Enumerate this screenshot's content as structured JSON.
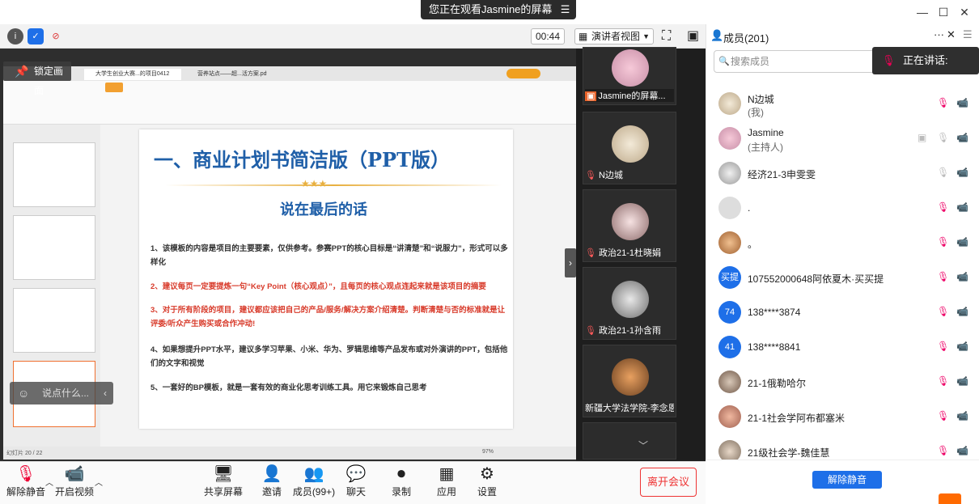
{
  "banner": {
    "viewing": "您正在观看Jasmine的屏幕"
  },
  "toolbar": {
    "timer": "00:44",
    "view_mode": "演讲者视图"
  },
  "share": {
    "lock_label": "锁定画面",
    "wps_tab1": "大学生创业大赛...的项目0412",
    "wps_tab2": "营养站点——超...活方案.pdf",
    "slide_title": "一、商业计划书简洁版（PPT版）",
    "slide_subtitle": "说在最后的话",
    "lines": [
      "1、该模板的内容是项目的主要要素，仅供参考。参赛PPT的核心目标是“讲清楚”和“说服力”，形式可以多样化",
      "2、建议每页一定要提炼一句“Key Point（核心观点）”，且每页的核心观点连起来就是该项目的摘要",
      "3、对于所有阶段的项目，建议都应该把自己的产品/服务/解决方案介绍清楚。判断清楚与否的标准就是让评委/听众产生购买或合作冲动!",
      "4、如果想提升PPT水平，建议多学习苹果、小米、华为、罗辑思维等产品发布或对外演讲的PPT，包括他们的文字和视觉",
      "5、一套好的BP模板，就是一套有效的商业化思考训练工具。用它来锻炼自己思考"
    ],
    "say_placeholder": "说点什么...",
    "status_left": "幻灯片 20 / 22",
    "zoom": "97%"
  },
  "video_tiles": [
    {
      "name": "Jasmine的屏幕..."
    },
    {
      "name": "N边城"
    },
    {
      "name": "政治21-1杜晓娟"
    },
    {
      "name": "政治21-1孙含雨"
    },
    {
      "name": "新疆大学法学院-李念恩"
    }
  ],
  "members": {
    "title": "成员(201)",
    "search_placeholder": "搜索成员",
    "speaking": "正在讲话:",
    "unmute_all": "解除静音",
    "list": [
      {
        "name": "N边城",
        "role": "(我)",
        "avatar": ""
      },
      {
        "name": "Jasmine",
        "role": "(主持人)",
        "avatar": ""
      },
      {
        "name": "经济21-3申雯雯",
        "role": "",
        "avatar": ""
      },
      {
        "name": ".",
        "role": "",
        "avatar": ""
      },
      {
        "name": "。",
        "role": "",
        "avatar": ""
      },
      {
        "name": "107552000648阿依夏木·买买提",
        "role": "",
        "avatar": "买提"
      },
      {
        "name": "138****3874",
        "role": "",
        "avatar": "74"
      },
      {
        "name": "138****8841",
        "role": "",
        "avatar": "41"
      },
      {
        "name": "21-1俄勒哈尔",
        "role": "",
        "avatar": ""
      },
      {
        "name": "21-1社会学阿布都塞米",
        "role": "",
        "avatar": ""
      },
      {
        "name": "21级社会学-魏佳慧",
        "role": "",
        "avatar": ""
      }
    ]
  },
  "bottom": {
    "unmute": "解除静音",
    "video": "开启视频",
    "share": "共享屏幕",
    "invite": "邀请",
    "members": "成员(99+)",
    "chat": "聊天",
    "record": "录制",
    "apps": "应用",
    "settings": "设置",
    "leave": "离开会议"
  }
}
